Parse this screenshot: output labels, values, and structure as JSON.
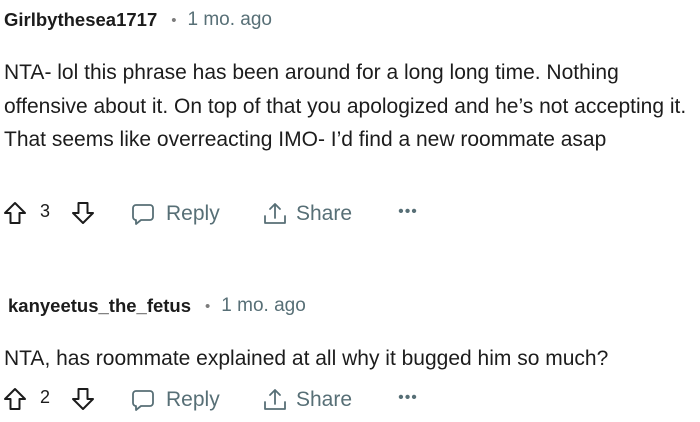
{
  "comments": [
    {
      "author": "Girlbythesea1717",
      "separator": "•",
      "time": "1 mo. ago",
      "body": "NTA- lol this phrase has been around for a long long time. Nothing offensive about it. On top of that you apologized and he’s not accepting it. That seems like overreacting IMO- I’d find a new roommate asap",
      "vote_count": "3",
      "reply_label": "Reply",
      "share_label": "Share",
      "more_label": "•••"
    },
    {
      "author": "kanyeetus_the_fetus",
      "separator": "•",
      "time": "1 mo. ago",
      "body": "NTA, has roommate explained at all why it bugged him so much?",
      "vote_count": "2",
      "reply_label": "Reply",
      "share_label": "Share",
      "more_label": "•••"
    }
  ],
  "icons": {
    "upvote": "upvote-arrow-icon",
    "downvote": "downvote-arrow-icon",
    "reply": "speech-bubble-icon",
    "share": "share-upload-icon",
    "more": "ellipsis-icon"
  },
  "colors": {
    "text": "#1c1c1c",
    "muted": "#576f76",
    "icon": "#1c1c1c"
  }
}
